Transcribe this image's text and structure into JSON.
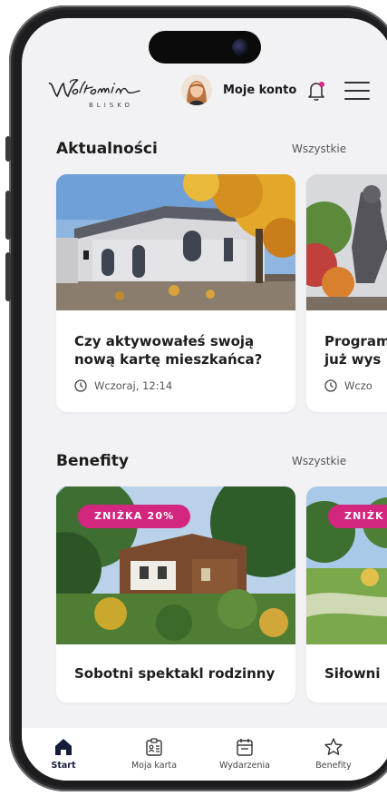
{
  "header": {
    "logo_text": "Wołomin",
    "logo_sub": "BLISKO",
    "account_label": "Moje konto"
  },
  "news": {
    "title": "Aktualności",
    "see_all": "Wszystkie",
    "cards": [
      {
        "title_line1": "Czy aktywowałeś swoją",
        "title_line2": "nową kartę mieszkańca?",
        "date": "Wczoraj, 12:14"
      },
      {
        "title_line1": "Program",
        "title_line2": "już wys",
        "date": "Wczo"
      }
    ]
  },
  "benefits": {
    "title": "Benefity",
    "see_all": "Wszystkie",
    "cards": [
      {
        "badge": "ZNIŻKA 20%",
        "title": "Sobotni spektakl rodzinny"
      },
      {
        "badge": "ZNIŻK",
        "title": "Siłowni"
      }
    ]
  },
  "nav": {
    "items": [
      {
        "label": "Start",
        "icon": "home-icon",
        "active": true
      },
      {
        "label": "Moja karta",
        "icon": "id-card-icon"
      },
      {
        "label": "Wydarzenia",
        "icon": "calendar-icon"
      },
      {
        "label": "Benefity",
        "icon": "star-icon"
      }
    ]
  },
  "colors": {
    "accent": "#d2267f",
    "nav_active": "#151c3b",
    "background": "#f2f2f5"
  }
}
